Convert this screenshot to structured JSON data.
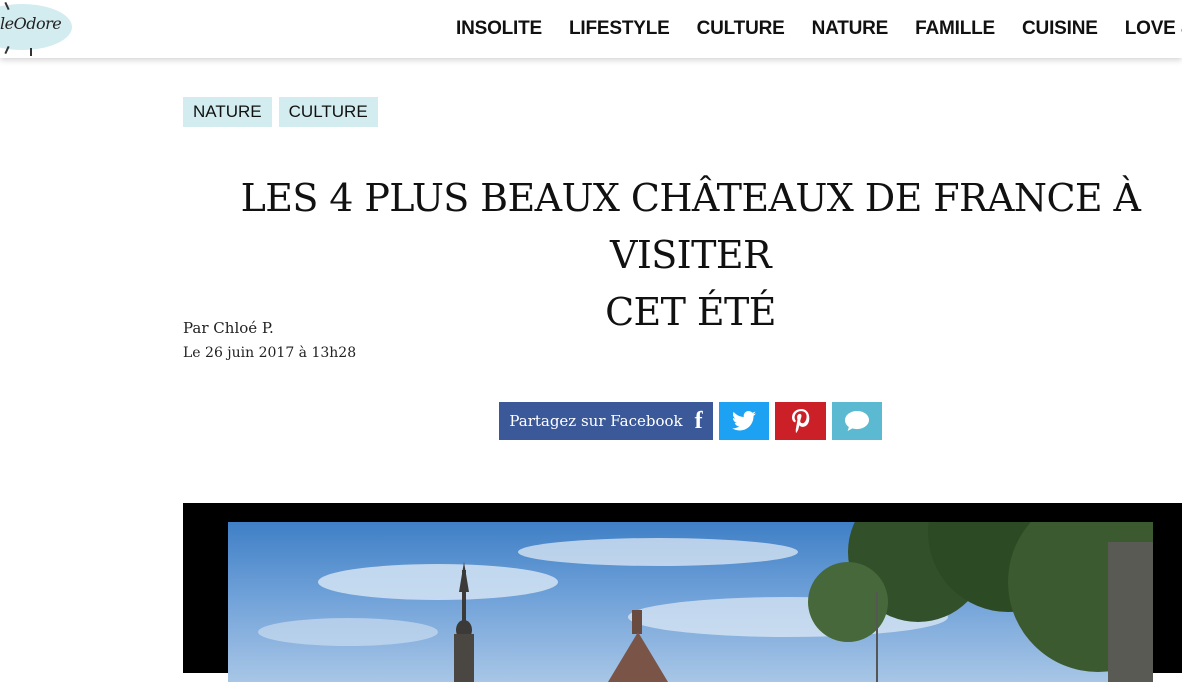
{
  "header": {
    "logo_text": "leOdore",
    "nav": [
      "INSOLITE",
      "LIFESTYLE",
      "CULTURE",
      "NATURE",
      "FAMILLE",
      "CUISINE",
      "LOVE &"
    ]
  },
  "article": {
    "tags": [
      "NATURE",
      "CULTURE"
    ],
    "title_line1": "LES 4 PLUS BEAUX CHÂTEAUX DE FRANCE À VISITER",
    "title_line2": "CET ÉTÉ",
    "author": "Par Chloé P.",
    "date": "Le 26 juin 2017 à 13h28"
  },
  "share": {
    "facebook_label": "Partagez sur Facebook",
    "colors": {
      "facebook": "#3b5998",
      "twitter": "#1da1f2",
      "pinterest": "#cb2027",
      "comment": "#5bbad1"
    },
    "icons": [
      "facebook-icon",
      "twitter-icon",
      "pinterest-icon",
      "comment-icon"
    ]
  },
  "theme": {
    "tag_background": "#d3ecf0"
  }
}
